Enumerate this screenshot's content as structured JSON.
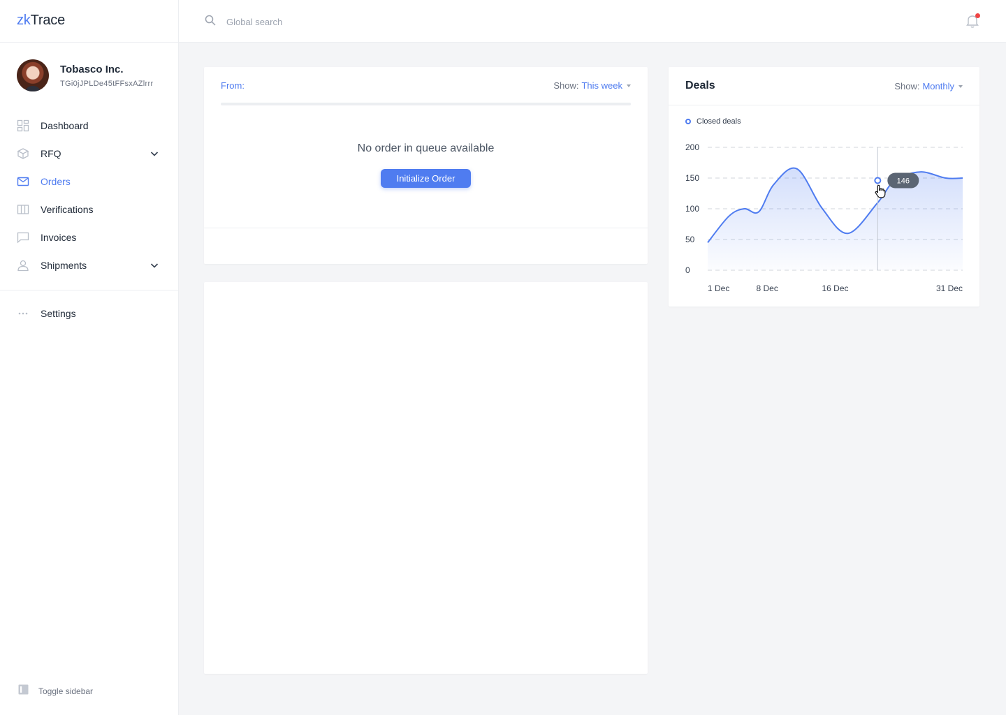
{
  "app": {
    "logo_prefix": "zk",
    "logo_suffix": "Trace"
  },
  "profile": {
    "company": "Tobasco Inc.",
    "user_id": "TGi0jJPLDe45tFFsxAZlrrr"
  },
  "sidebar": {
    "items": [
      {
        "label": "Dashboard",
        "icon": "dashboard-icon",
        "active": false,
        "expandable": false
      },
      {
        "label": "RFQ",
        "icon": "box-icon",
        "active": false,
        "expandable": true
      },
      {
        "label": "Orders",
        "icon": "mail-icon",
        "active": true,
        "expandable": false
      },
      {
        "label": "Verifications",
        "icon": "columns-icon",
        "active": false,
        "expandable": false
      },
      {
        "label": "Invoices",
        "icon": "chat-icon",
        "active": false,
        "expandable": false
      },
      {
        "label": "Shipments",
        "icon": "user-icon",
        "active": false,
        "expandable": true
      }
    ],
    "settings_label": "Settings",
    "toggle_label": "Toggle sidebar"
  },
  "topbar": {
    "search_placeholder": "Global search",
    "notifications_unread": true
  },
  "orders": {
    "from_label": "From:",
    "show_label": "Show:",
    "show_value": "This week",
    "progress": 0,
    "empty_message": "No order in queue available",
    "init_button": "Initialize Order"
  },
  "deals": {
    "title": "Deals",
    "show_label": "Show:",
    "show_value": "Monthly"
  },
  "chart_data": {
    "type": "area",
    "title": "Deals",
    "xlabel": "",
    "ylabel": "",
    "ylim": [
      0,
      200
    ],
    "yticks": [
      0,
      50,
      100,
      150,
      200
    ],
    "x_tick_labels": [
      "1 Dec",
      "8 Dec",
      "16 Dec",
      "31 Dec"
    ],
    "x_tick_positions": [
      1,
      8,
      16,
      31
    ],
    "xlim": [
      1,
      31
    ],
    "grid": true,
    "legend": "top-left",
    "series": [
      {
        "name": "Closed deals",
        "color": "#4f7cf0",
        "x": [
          1,
          3.5,
          5.3,
          7,
          8.8,
          11.5,
          14.5,
          17.5,
          21,
          23,
          26,
          29,
          31
        ],
        "y": [
          45,
          88,
          100,
          95,
          140,
          165,
          100,
          60,
          110,
          146,
          160,
          150,
          150
        ]
      }
    ],
    "tooltip": {
      "x": 21,
      "value": 146
    }
  }
}
